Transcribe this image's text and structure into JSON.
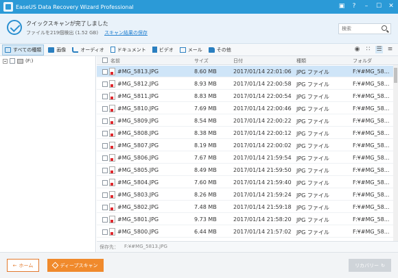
{
  "window": {
    "title": "EaseUS Data Recovery Wizard Professional"
  },
  "title_controls": {
    "gift": "▣",
    "help": "?",
    "minimize": "–",
    "restore": "☐",
    "close": "✕"
  },
  "status": {
    "title": "クイックスキャンが完了しました",
    "subtitle": "ファイルを219個検出 (1.52 GB)",
    "save_link": "スキャン結果の保存"
  },
  "search": {
    "placeholder": "検索"
  },
  "filters": [
    {
      "label": "すべての種類",
      "icon": "monitor-icon",
      "active": true
    },
    {
      "label": "画像",
      "icon": "image-icon",
      "active": false
    },
    {
      "label": "オーディオ",
      "icon": "audio-icon",
      "active": false
    },
    {
      "label": "ドキュメント",
      "icon": "document-icon",
      "active": false
    },
    {
      "label": "ビデオ",
      "icon": "video-icon",
      "active": false
    },
    {
      "label": "メール",
      "icon": "mail-icon",
      "active": false
    },
    {
      "label": "その他",
      "icon": "folder-icon",
      "active": false
    }
  ],
  "view_icons": {
    "preview": "◉",
    "grid": "∷",
    "list": "☰",
    "details": "≡"
  },
  "tree": {
    "drive_label": "(F:)"
  },
  "table": {
    "headers": {
      "name": "名前",
      "size": "サイズ",
      "date": "日付",
      "type": "種類",
      "folder": "フォルダ"
    },
    "rows": [
      {
        "name": "#MG_5813.JPG",
        "size": "8.60 MB",
        "date": "2017/01/14 22:01:06",
        "type": "JPG ファイル",
        "folder": "F:¥#MG_58..."
      },
      {
        "name": "#MG_5812.JPG",
        "size": "8.93 MB",
        "date": "2017/01/14 22:00:58",
        "type": "JPG ファイル",
        "folder": "F:¥#MG_58..."
      },
      {
        "name": "#MG_5811.JPG",
        "size": "8.83 MB",
        "date": "2017/01/14 22:00:54",
        "type": "JPG ファイル",
        "folder": "F:¥#MG_58..."
      },
      {
        "name": "#MG_5810.JPG",
        "size": "7.69 MB",
        "date": "2017/01/14 22:00:46",
        "type": "JPG ファイル",
        "folder": "F:¥#MG_58..."
      },
      {
        "name": "#MG_5809.JPG",
        "size": "8.54 MB",
        "date": "2017/01/14 22:00:22",
        "type": "JPG ファイル",
        "folder": "F:¥#MG_58..."
      },
      {
        "name": "#MG_5808.JPG",
        "size": "8.38 MB",
        "date": "2017/01/14 22:00:12",
        "type": "JPG ファイル",
        "folder": "F:¥#MG_58..."
      },
      {
        "name": "#MG_5807.JPG",
        "size": "8.19 MB",
        "date": "2017/01/14 22:00:02",
        "type": "JPG ファイル",
        "folder": "F:¥#MG_58..."
      },
      {
        "name": "#MG_5806.JPG",
        "size": "7.67 MB",
        "date": "2017/01/14 21:59:54",
        "type": "JPG ファイル",
        "folder": "F:¥#MG_58..."
      },
      {
        "name": "#MG_5805.JPG",
        "size": "8.49 MB",
        "date": "2017/01/14 21:59:50",
        "type": "JPG ファイル",
        "folder": "F:¥#MG_58..."
      },
      {
        "name": "#MG_5804.JPG",
        "size": "7.60 MB",
        "date": "2017/01/14 21:59:40",
        "type": "JPG ファイル",
        "folder": "F:¥#MG_58..."
      },
      {
        "name": "#MG_5803.JPG",
        "size": "8.26 MB",
        "date": "2017/01/14 21:59:24",
        "type": "JPG ファイル",
        "folder": "F:¥#MG_58..."
      },
      {
        "name": "#MG_5802.JPG",
        "size": "7.48 MB",
        "date": "2017/01/14 21:59:18",
        "type": "JPG ファイル",
        "folder": "F:¥#MG_58..."
      },
      {
        "name": "#MG_5801.JPG",
        "size": "9.73 MB",
        "date": "2017/01/14 21:58:20",
        "type": "JPG ファイル",
        "folder": "F:¥#MG_58..."
      },
      {
        "name": "#MG_5800.JPG",
        "size": "6.44 MB",
        "date": "2017/01/14 21:57:02",
        "type": "JPG ファイル",
        "folder": "F:¥#MG_58..."
      }
    ]
  },
  "pathbar": {
    "label": "保存先：",
    "value": "F:¥#MG_5813.JPG"
  },
  "footer": {
    "home": "ホーム",
    "deep_scan": "ディープスキャン",
    "recover": "リカバリー"
  },
  "colors": {
    "titlebar": "#2b9ad7",
    "accent_orange": "#f08a2c",
    "selected_row": "#cfe5f8"
  }
}
